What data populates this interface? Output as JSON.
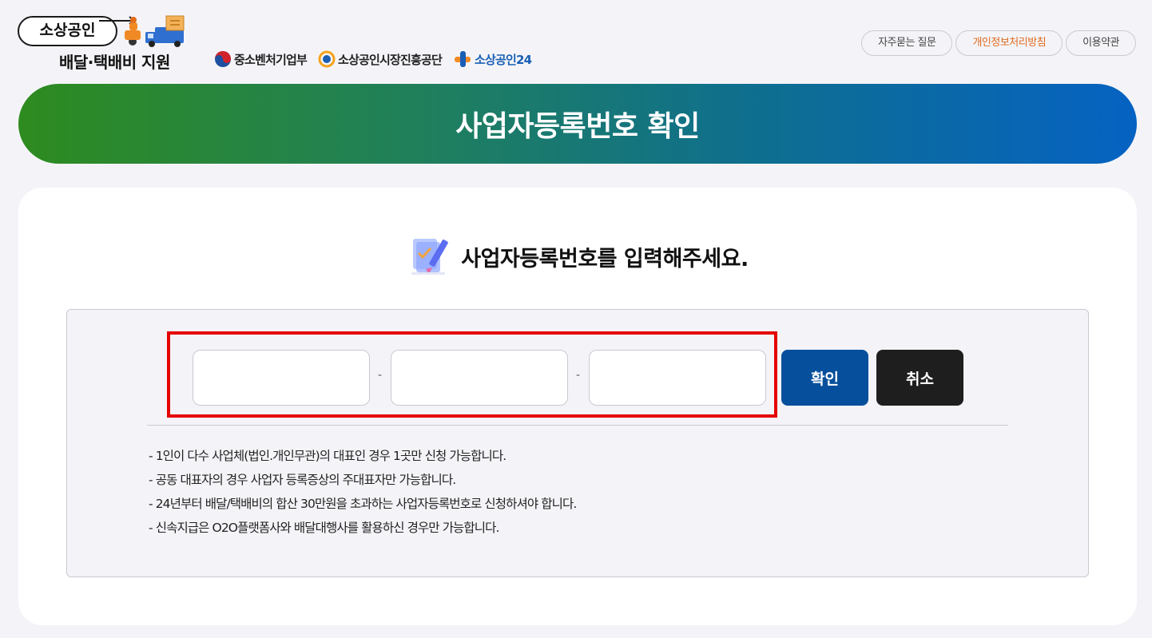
{
  "header": {
    "logo_main": "소상공인",
    "logo_sub": "배달·택배비 지원",
    "partners": [
      "중소벤처기업부",
      "소상공인시장진흥공단",
      "소상공인24"
    ],
    "top_links": [
      "자주묻는 질문",
      "개인정보처리방침",
      "이용약관"
    ]
  },
  "banner": {
    "title": "사업자등록번호 확인"
  },
  "form": {
    "prompt": "사업자등록번호를 입력해주세요.",
    "inputs": [
      {
        "value": "",
        "placeholder": ""
      },
      {
        "value": "",
        "placeholder": ""
      },
      {
        "value": "",
        "placeholder": ""
      }
    ],
    "separator": "-",
    "confirm_label": "확인",
    "cancel_label": "취소"
  },
  "notes": [
    "-  1인이 다수 사업체(법인.개인무관)의 대표인 경우 1곳만 신청 가능합니다.",
    "-  공동 대표자의 경우 사업자 등록증상의 주대표자만 가능합니다.",
    "-  24년부터 배달/택배비의 합산 30만원을 초과하는 사업자등록번호로 신청하셔야 합니다.",
    "-  신속지급은 O2O플랫폼사와 배달대행사를 활용하신 경우만 가능합니다."
  ],
  "colors": {
    "banner_start": "#2e8b1f",
    "banner_end": "#0562c2",
    "confirm_button": "#064f9c",
    "cancel_button": "#1e1e1e",
    "highlight_border": "#e50000",
    "privacy_link": "#e06b1f"
  }
}
